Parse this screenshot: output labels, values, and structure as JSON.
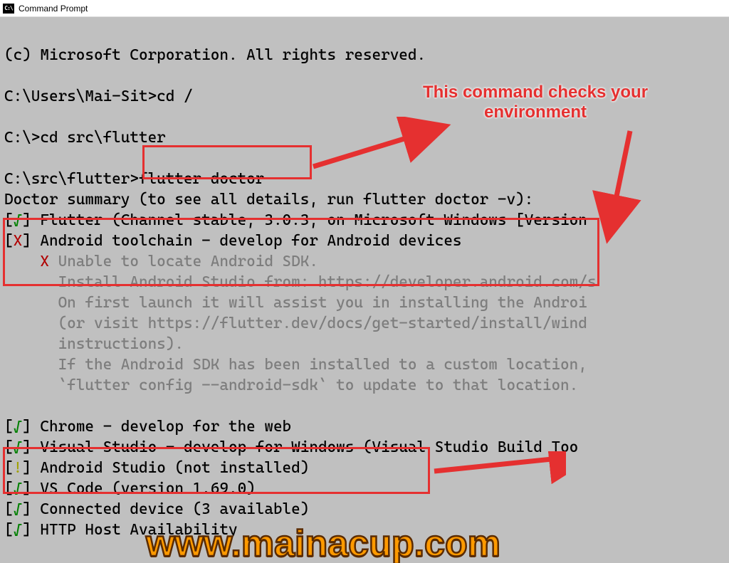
{
  "window": {
    "title": "Command Prompt"
  },
  "terminal": {
    "copyright": "(c) Microsoft Corporation. All rights reserved.",
    "prompt1": "C:\\Users\\Mai-Sit>",
    "cmd1": "cd /",
    "prompt2": "C:\\>",
    "cmd2": "cd src\\flutter",
    "prompt3": "C:\\src\\flutter>",
    "cmd3": "flutter doctor",
    "doctor_summary_pre": "Doctor summary ",
    "doctor_summary_post": "(to see all details, run flutter doctor -v):",
    "check_open": "[",
    "check_mark": "√",
    "check_close": "] ",
    "x_mark": "X",
    "bang_mark": "!",
    "flutter_line": "Flutter (Channel stable, 3.0.3, on Microsoft Windows [Version",
    "android_tc_line": "Android toolchain - develop for Android devices",
    "android_x_prefix": "    ",
    "android_x_mark": "X",
    "android_unable": " Unable to locate Android SDK.",
    "android_install": "      Install Android Studio from: https://developer.",
    "android_install_tail": "android.com/s",
    "android_first": "      On first launch it will assist you in installing the Androi",
    "android_visit": "      (or visit https://flutter.dev/docs/get-started/install/wind",
    "android_instr": "      instructions).",
    "android_sdk_custom": "      If the Android SDK has been installed to a custom location,",
    "android_config": "      `flutter config --android-sdk` to update to that location.",
    "chrome_line": "Chrome - develop for the web",
    "visualstudio_line": "Visual Studio - develop for Windows (Visual Studio Build Too",
    "androidstudio_line": "Android Studio (not installed)",
    "vscode_line": "VS Code (version 1.69.0)",
    "connected_line": "Connected device (3 available)",
    "http_line": "HTTP Host Availability"
  },
  "annotations": {
    "callout": "This command checks your\nenvironment"
  },
  "watermark": "www.mainacup.com"
}
